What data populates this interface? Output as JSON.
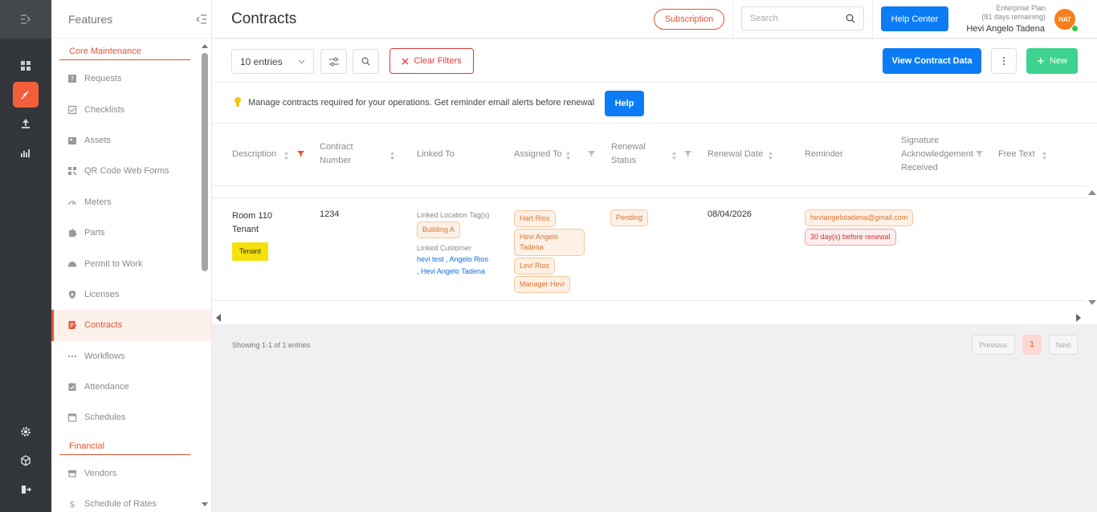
{
  "sidebar": {
    "title": "Features",
    "sections": [
      {
        "label": "Core Maintenance"
      },
      {
        "label": "Financial"
      }
    ],
    "items": [
      {
        "label": "Requests",
        "icon": "request-icon"
      },
      {
        "label": "Checklists",
        "icon": "checklist-icon"
      },
      {
        "label": "Assets",
        "icon": "asset-icon"
      },
      {
        "label": "QR Code Web Forms",
        "icon": "qr-code-icon"
      },
      {
        "label": "Meters",
        "icon": "meter-icon"
      },
      {
        "label": "Parts",
        "icon": "puzzle-icon"
      },
      {
        "label": "Permit to Work",
        "icon": "permit-icon"
      },
      {
        "label": "Licenses",
        "icon": "shield-icon"
      },
      {
        "label": "Contracts",
        "icon": "contract-icon",
        "active": true
      },
      {
        "label": "Workflows",
        "icon": "workflow-icon"
      },
      {
        "label": "Attendance",
        "icon": "attendance-icon"
      },
      {
        "label": "Schedules",
        "icon": "calendar-icon"
      },
      {
        "label": "Vendors",
        "icon": "vendor-icon"
      },
      {
        "label": "Schedule of Rates",
        "icon": "dollar-icon"
      }
    ]
  },
  "header": {
    "title": "Contracts",
    "subscription_label": "Subscription",
    "search_placeholder": "Search",
    "help_center_label": "Help Center",
    "plan_line1": "Enterprise Plan",
    "plan_line2": "(81 days remaining)",
    "user_name": "Hevi Angelo Tadena",
    "avatar_initials": "HAT"
  },
  "toolbar": {
    "entries_label": "10 entries",
    "clear_filters_label": "Clear Filters",
    "view_contract_data_label": "View Contract Data",
    "new_label": "New"
  },
  "info": {
    "text": "Manage contracts required for your operations. Get reminder email alerts before renewal",
    "help_label": "Help"
  },
  "table": {
    "headers": {
      "description": "Description",
      "contract_number_1": "Contract",
      "contract_number_2": "Number",
      "linked_to": "Linked To",
      "assigned_to": "Assigned To",
      "renewal_status_1": "Renewal",
      "renewal_status_2": "Status",
      "renewal_date": "Renewal Date",
      "reminder": "Reminder",
      "signature_1": "Signature",
      "signature_2": "Acknowledgement",
      "signature_3": "Received",
      "free_text": "Free Text"
    },
    "rows": [
      {
        "description_1": "Room 110",
        "description_2": "Tenant",
        "tag": "Tenant",
        "contract_number": "1234",
        "linked_location_label": "Linked Location Tag(s)",
        "location_tag": "Building A",
        "linked_customer_label": "Linked Customer",
        "customer_1": "hevi test",
        "customer_sep1": " , ",
        "customer_2": "Angelo Rios",
        "customer_sep2": ", ",
        "customer_3": "Hevi Angelo Tadena",
        "assigned": [
          "Hart Rios",
          "Hevi Angelo",
          "Tadena",
          "Levi Rios",
          "Manager Hevi"
        ],
        "renewal_status": "Pending",
        "renewal_date": "08/04/2026",
        "reminder_email": "heviangelotadena@gmail.com",
        "reminder_days": "30 day(s) before renewal"
      }
    ]
  },
  "pagination": {
    "showing": "Showing 1-1 of 1 entries",
    "previous": "Previous",
    "current": "1",
    "next": "Next"
  },
  "colors": {
    "accent": "#e8542f",
    "primary": "#0b7cf5",
    "success": "#3dd28f",
    "rail": "#33363b"
  }
}
